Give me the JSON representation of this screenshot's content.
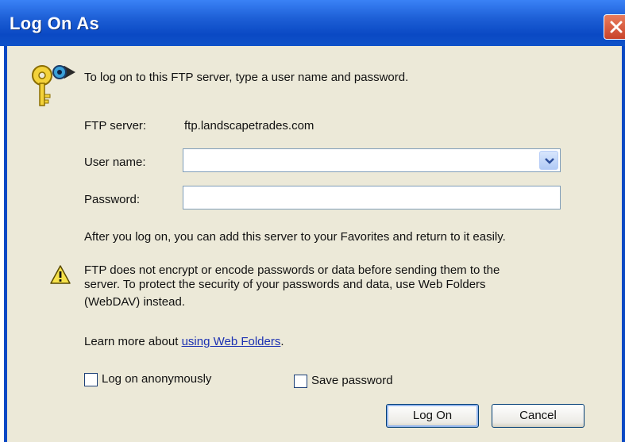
{
  "window": {
    "title": "Log On As"
  },
  "intro": {
    "text": "To log on to this FTP server, type a user name and password."
  },
  "form": {
    "server_label": "FTP server:",
    "server_value": "ftp.landscapetrades.com",
    "username_label": "User name:",
    "username_value": "",
    "password_label": "Password:",
    "password_value": ""
  },
  "favorites_note": "After you log on, you can add this server to your Favorites and return to it easily.",
  "warning": {
    "line1": "FTP does not encrypt or encode passwords or data before sending them to the",
    "line2": "server.  To protect the security of your passwords and data, use Web Folders",
    "line3": "(WebDAV) instead."
  },
  "learn_more": {
    "prefix": "Learn more about ",
    "link": "using Web Folders",
    "suffix": "."
  },
  "options": {
    "anonymous_label": "Log on anonymously",
    "anonymous_checked": false,
    "save_password_label": "Save password",
    "save_password_checked": false
  },
  "buttons": {
    "logon": "Log On",
    "cancel": "Cancel"
  },
  "colors": {
    "titlebar": "#0a49c4",
    "dialog_bg": "#ece9d8",
    "link": "#1c31b2",
    "close": "#d2543a"
  },
  "icons": {
    "close": "close-icon",
    "keys": "keys-icon",
    "warning": "warning-icon",
    "dropdown": "chevron-down-icon"
  }
}
